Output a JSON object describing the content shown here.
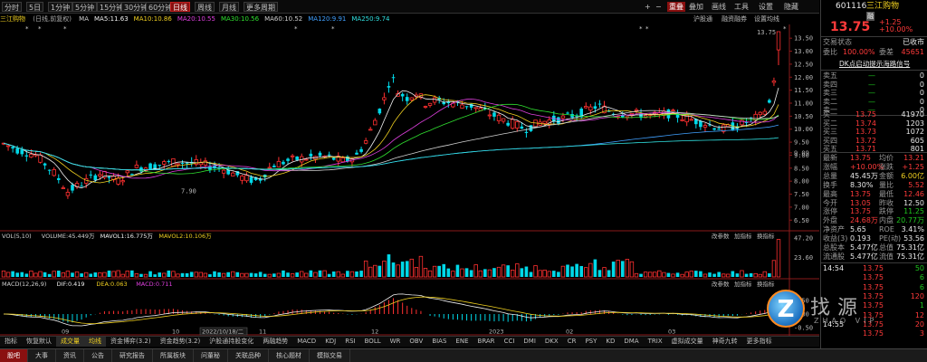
{
  "toolbar": {
    "left_buttons": [
      "分时",
      "5日",
      "1分钟",
      "5分钟",
      "15分钟",
      "30分钟",
      "60分钟",
      "日线",
      "周线",
      "月线",
      "更多周期"
    ],
    "active_index": 7,
    "right_items": [
      "+",
      "−",
      "重叠",
      "叠加",
      "画线",
      "工具",
      "设置",
      "隐藏"
    ],
    "right_active": "重叠"
  },
  "ma_row": {
    "title": "三江购物",
    "mode": "(日线,前复权)",
    "items": [
      {
        "label": "MA",
        "color": "#d0d0d0"
      },
      {
        "label": "MA5:11.63",
        "color": "#f0f0f0"
      },
      {
        "label": "MA10:10.86",
        "color": "#f0d020"
      },
      {
        "label": "MA20:10.55",
        "color": "#e040e0"
      },
      {
        "label": "MA30:10.56",
        "color": "#30e030"
      },
      {
        "label": "MA60:10.52",
        "color": "#d0d0d0"
      },
      {
        "label": "MA120:9.91",
        "color": "#40a0ff"
      },
      {
        "label": "MA250:9.74",
        "color": "#30e0e0"
      }
    ],
    "right_links": [
      "沪股通",
      "融资融券",
      "设置均线"
    ]
  },
  "axis": {
    "price_ticks": [
      "13.50",
      "13.00",
      "12.50",
      "12.00",
      "11.50",
      "11.00",
      "10.50",
      "10.00",
      "9.50",
      "9.09",
      "9.00",
      "8.50",
      "8.00",
      "7.50",
      "7.00",
      "6.50",
      "6.00"
    ],
    "high_label": "13.75",
    "low_label": "7.90",
    "vol_ticks": [
      "47.20",
      "23.60",
      "万"
    ],
    "macd_ticks": [
      "0.50",
      "0.00",
      "-0.50"
    ],
    "time_labels": [
      "09",
      "10",
      "2022/10/18/二",
      "11",
      "12",
      "2023",
      "02",
      "03"
    ]
  },
  "volume": {
    "header": [
      "VOL(5,10)",
      "VOLUME:45.449万",
      "MAVOL1:16.775万",
      "MAVOL2:10.106万"
    ],
    "header_colors": [
      "#d0d0d0",
      "#d0d0d0",
      "#f0f0f0",
      "#f0d020"
    ],
    "right": [
      "改参数",
      "加指标",
      "换指标"
    ]
  },
  "macd": {
    "header": [
      "MACD(12,26,9)",
      "DIF:0.419",
      "DEA:0.063",
      "MACD:0.711"
    ],
    "header_colors": [
      "#d0d0d0",
      "#f0f0f0",
      "#f0d020",
      "#e040e0"
    ],
    "right": [
      "改参数",
      "加指标",
      "换指标"
    ]
  },
  "tabs": [
    "指标",
    "恢复默认",
    "成交量",
    "均线",
    "资金博弈(3.2)",
    "资金趋势(3.2)",
    "沪股通持股变化",
    "两融趋势",
    "MACD",
    "KDJ",
    "RSI",
    "BOLL",
    "WR",
    "OBV",
    "BIAS",
    "ENE",
    "BRAR",
    "CCI",
    "DMI",
    "DKX",
    "CR",
    "PSY",
    "KD",
    "DMA",
    "TRIX",
    "虚拟成交量",
    "神奇九转",
    "更多指标"
  ],
  "tabs_active": [
    2,
    3
  ],
  "bottom": [
    "股吧",
    "大事",
    "资讯",
    "公告",
    "研究报告",
    "所属板块",
    "问董秘",
    "关联品种",
    "核心题材",
    "模拟交易"
  ],
  "panel": {
    "code": "601116",
    "name": "三江购物",
    "tag": "融",
    "price": "13.75",
    "change": "+1.25",
    "change_pct": "+10.00%",
    "status_label": "交易状态",
    "status_value": "已收市",
    "weibi_label": "委比",
    "weibi_value": "100.00%",
    "weicha_label": "委差",
    "weicha_value": "45651",
    "notice": "DK点启动提示海路信号",
    "sell": [
      {
        "label": "卖五",
        "price": "—",
        "vol": "0"
      },
      {
        "label": "卖四",
        "price": "—",
        "vol": "0"
      },
      {
        "label": "卖三",
        "price": "—",
        "vol": "0"
      },
      {
        "label": "卖二",
        "price": "—",
        "vol": "0"
      },
      {
        "label": "卖一",
        "price": "—",
        "vol": "0"
      }
    ],
    "buy": [
      {
        "label": "买一",
        "price": "13.75",
        "vol": "41970"
      },
      {
        "label": "买二",
        "price": "13.74",
        "vol": "1203"
      },
      {
        "label": "买三",
        "price": "13.73",
        "vol": "1072"
      },
      {
        "label": "买四",
        "price": "13.72",
        "vol": "605"
      },
      {
        "label": "买五",
        "price": "13.71",
        "vol": "801"
      }
    ],
    "stats": [
      {
        "l1": "最新",
        "v1": "13.75",
        "c1": "red",
        "l2": "均价",
        "v2": "13.21",
        "c2": "red"
      },
      {
        "l1": "涨幅",
        "v1": "+10.00%",
        "c1": "red",
        "l2": "涨跌",
        "v2": "+1.25",
        "c2": "red"
      },
      {
        "l1": "总量",
        "v1": "45.45万",
        "c1": "wht",
        "l2": "金额",
        "v2": "6.00亿",
        "c2": "yel"
      },
      {
        "l1": "换手",
        "v1": "8.30%",
        "c1": "wht",
        "l2": "量比",
        "v2": "5.52",
        "c2": "red"
      },
      {
        "l1": "最高",
        "v1": "13.75",
        "c1": "red",
        "l2": "最低",
        "v2": "12.46",
        "c2": "red"
      },
      {
        "l1": "今开",
        "v1": "13.05",
        "c1": "red",
        "l2": "昨收",
        "v2": "12.50",
        "c2": "wht"
      },
      {
        "l1": "涨停",
        "v1": "13.75",
        "c1": "red",
        "l2": "跌停",
        "v2": "11.25",
        "c2": "grn"
      },
      {
        "l1": "外盘",
        "v1": "24.68万",
        "c1": "red",
        "l2": "内盘",
        "v2": "20.77万",
        "c2": "grn"
      },
      {
        "l1": "净资产",
        "v1": "5.65",
        "c1": "wht",
        "l2": "ROE",
        "v2": "3.41%",
        "c2": "wht"
      },
      {
        "l1": "收益(3)",
        "v1": "0.193",
        "c1": "wht",
        "l2": "PE(动)",
        "v2": "53.56",
        "c2": "wht"
      },
      {
        "l1": "总股本",
        "v1": "5.477亿",
        "c1": "wht",
        "l2": "总值",
        "v2": "75.31亿",
        "c2": "wht"
      },
      {
        "l1": "流通股",
        "v1": "5.477亿",
        "c1": "wht",
        "l2": "流值",
        "v2": "75.31亿",
        "c2": "wht"
      }
    ],
    "ticks": [
      {
        "t": "14:54",
        "p": "13.75",
        "v": "50",
        "c": "grn"
      },
      {
        "t": "",
        "p": "13.75",
        "v": "6",
        "c": "grn"
      },
      {
        "t": "",
        "p": "13.75",
        "v": "6",
        "c": "grn"
      },
      {
        "t": "",
        "p": "13.75",
        "v": "120",
        "c": "red"
      },
      {
        "t": "",
        "p": "13.75",
        "v": "1",
        "c": "grn"
      },
      {
        "t": "",
        "p": "13.75",
        "v": "12",
        "c": "red"
      },
      {
        "t": "14:55",
        "p": "13.75",
        "v": "20",
        "c": "red"
      },
      {
        "t": "",
        "p": "13.75",
        "v": "3",
        "c": "red"
      }
    ],
    "watermark": "找源",
    "watermark_sub": "ZHAO VIP"
  }
}
